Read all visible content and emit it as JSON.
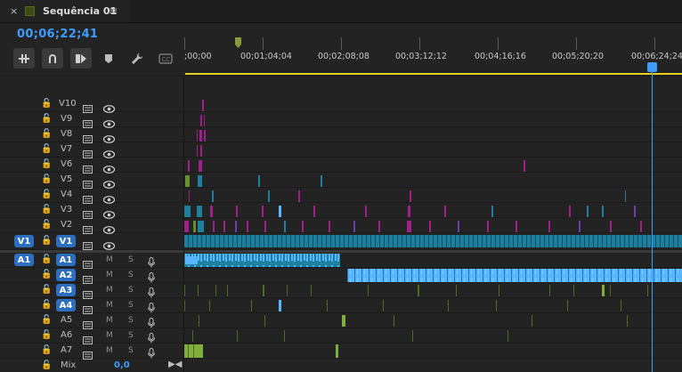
{
  "tab": {
    "close": "×",
    "title": "Sequência 01",
    "menu": "≡"
  },
  "timecode": "00;06;22;41",
  "ruler": {
    "ticks": [
      ";00;00",
      "00;01;04;04",
      "00;02;08;08",
      "00;03;12;12",
      "00;04;16;16",
      "00;05;20;20",
      "00;06;24;24"
    ]
  },
  "video_tracks": [
    "V10",
    "V9",
    "V8",
    "V7",
    "V6",
    "V5",
    "V4",
    "V3",
    "V2",
    "V1"
  ],
  "audio_tracks": [
    "A1",
    "A2",
    "A3",
    "A4",
    "A5",
    "A6",
    "A7"
  ],
  "source_patch": {
    "video": "V1",
    "audio": "A1"
  },
  "audio_buttons": {
    "mute": "M",
    "solo": "S"
  },
  "mix": {
    "label": "Mix",
    "value": "0,0"
  },
  "colors": {
    "accent": "#3f9cff",
    "video_clip": "#1f7f9e",
    "audio_clip": "#56b7ff",
    "green_clip": "#6a8f2a",
    "magenta": "#a0208a",
    "work_bar": "#e6d023"
  }
}
